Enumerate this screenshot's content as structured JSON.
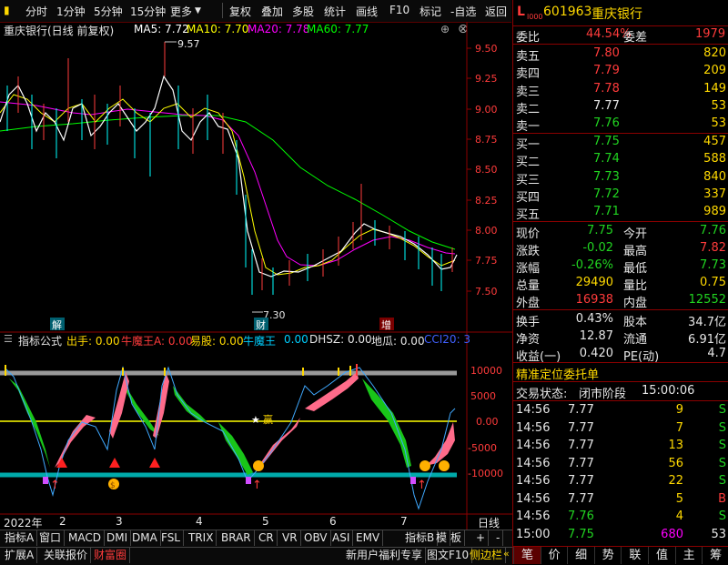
{
  "toolbar": {
    "items": [
      "分时",
      "1分钟",
      "5分钟",
      "15分钟",
      "更多",
      "复权",
      "叠加",
      "多股",
      "统计",
      "画线",
      "F10",
      "标记",
      "-自选",
      "返回"
    ]
  },
  "chart": {
    "title": "重庆银行(日线 前复权)",
    "ma5": "MA5: 7.72",
    "ma10": "MA10: 7.70",
    "ma20": "MA20: 7.78",
    "ma60": "MA60: 7.77",
    "price_ticks": [
      "9.50",
      "9.25",
      "9.00",
      "8.75",
      "8.50",
      "8.25",
      "8.00",
      "7.75",
      "7.50"
    ],
    "high_label": "9.57",
    "low_label": "7.30",
    "markers": {
      "jie": "解",
      "cai": "财",
      "zeng": "增"
    },
    "colors": {
      "ma5": "#ffffff",
      "ma10": "#ffff00",
      "ma20": "#ff00ff",
      "ma60": "#00ff00"
    }
  },
  "indicator": {
    "name": "指标公式",
    "chushou": "出手: 0.00",
    "niumowang_a": "牛魔王A: 0.00",
    "yigu": "易股: 0.00",
    "niumowang": "牛魔王",
    "niumowang_val": "0.00",
    "dhsz": "DHSZ: 0.00",
    "digua": "地瓜: 0.00",
    "cci": "CCI20: 3",
    "ticks": [
      "10000",
      "5000",
      "0.00",
      "-5000",
      "-10000"
    ],
    "zhuan": "赢"
  },
  "x_axis": {
    "labels": [
      "2022年",
      "2",
      "3",
      "4",
      "5",
      "6",
      "7"
    ],
    "period": "日线"
  },
  "bottom_tabs": [
    "指标A",
    "窗口",
    "MACD",
    "DMI",
    "DMA",
    "FSL",
    "TRIX",
    "BRAR",
    "CR",
    "VR",
    "OBV",
    "ASI",
    "EMV"
  ],
  "bottom_tabs_right": [
    "指标B",
    "模",
    "板",
    "+",
    "-"
  ],
  "bottom_bar": {
    "left": [
      "扩展A",
      "关联报价",
      "财富圈"
    ],
    "right": [
      "新用户福利专享",
      "图文F10",
      "侧边栏"
    ]
  },
  "nav_tabs": [
    "笔",
    "价",
    "细",
    "势",
    "联",
    "值",
    "主",
    "筹"
  ],
  "quote": {
    "prefix": "L",
    "level": "l000",
    "code": "601963",
    "name": "重庆银行",
    "weibi_label": "委比",
    "weibi": "44.54%",
    "weicha_label": "委差",
    "weicha": "1979",
    "asks": [
      {
        "label": "卖五",
        "price": "7.80",
        "vol": "820"
      },
      {
        "label": "卖四",
        "price": "7.79",
        "vol": "209"
      },
      {
        "label": "卖三",
        "price": "7.78",
        "vol": "149"
      },
      {
        "label": "卖二",
        "price": "7.77",
        "vol": "53"
      },
      {
        "label": "卖一",
        "price": "7.76",
        "vol": "53"
      }
    ],
    "bids": [
      {
        "label": "买一",
        "price": "7.75",
        "vol": "457"
      },
      {
        "label": "买二",
        "price": "7.74",
        "vol": "588"
      },
      {
        "label": "买三",
        "price": "7.73",
        "vol": "840"
      },
      {
        "label": "买四",
        "price": "7.72",
        "vol": "337"
      },
      {
        "label": "买五",
        "price": "7.71",
        "vol": "989"
      }
    ],
    "stats": [
      {
        "l1": "现价",
        "v1": "7.75",
        "c1": "green",
        "l2": "今开",
        "v2": "7.76",
        "c2": "green"
      },
      {
        "l1": "涨跌",
        "v1": "-0.02",
        "c1": "green",
        "l2": "最高",
        "v2": "7.82",
        "c2": "red"
      },
      {
        "l1": "涨幅",
        "v1": "-0.26%",
        "c1": "green",
        "l2": "最低",
        "v2": "7.73",
        "c2": "green"
      },
      {
        "l1": "总量",
        "v1": "29490",
        "c1": "yellow",
        "l2": "量比",
        "v2": "0.75",
        "c2": "yellow"
      },
      {
        "l1": "外盘",
        "v1": "16938",
        "c1": "red",
        "l2": "内盘",
        "v2": "12552",
        "c2": "green"
      }
    ],
    "stats2": [
      {
        "l1": "换手",
        "v1": "0.43%",
        "l2": "股本",
        "v2": "34.7亿"
      },
      {
        "l1": "净资",
        "v1": "12.87",
        "l2": "流通",
        "v2": "6.91亿"
      },
      {
        "l1": "收益(一)",
        "v1": "0.420",
        "l2": "PE(动)",
        "v2": "4.7"
      }
    ],
    "precision_title": "精准定位委托单",
    "trade_status_label": "交易状态:",
    "trade_status": "闭市阶段",
    "trade_time": "15:00:06",
    "ticks": [
      {
        "t": "14:56",
        "p": "7.77",
        "pc": "white",
        "v": "9",
        "f": "S"
      },
      {
        "t": "14:56",
        "p": "7.77",
        "pc": "white",
        "v": "7",
        "f": "S"
      },
      {
        "t": "14:56",
        "p": "7.77",
        "pc": "white",
        "v": "13",
        "f": "S"
      },
      {
        "t": "14:56",
        "p": "7.77",
        "pc": "white",
        "v": "56",
        "f": "S"
      },
      {
        "t": "14:56",
        "p": "7.77",
        "pc": "white",
        "v": "22",
        "f": "S"
      },
      {
        "t": "14:56",
        "p": "7.77",
        "pc": "white",
        "v": "5",
        "f": "B"
      },
      {
        "t": "14:56",
        "p": "7.76",
        "pc": "green",
        "v": "4",
        "f": "S"
      },
      {
        "t": "15:00",
        "p": "7.75",
        "pc": "green",
        "v": "680",
        "f": "53"
      }
    ]
  }
}
